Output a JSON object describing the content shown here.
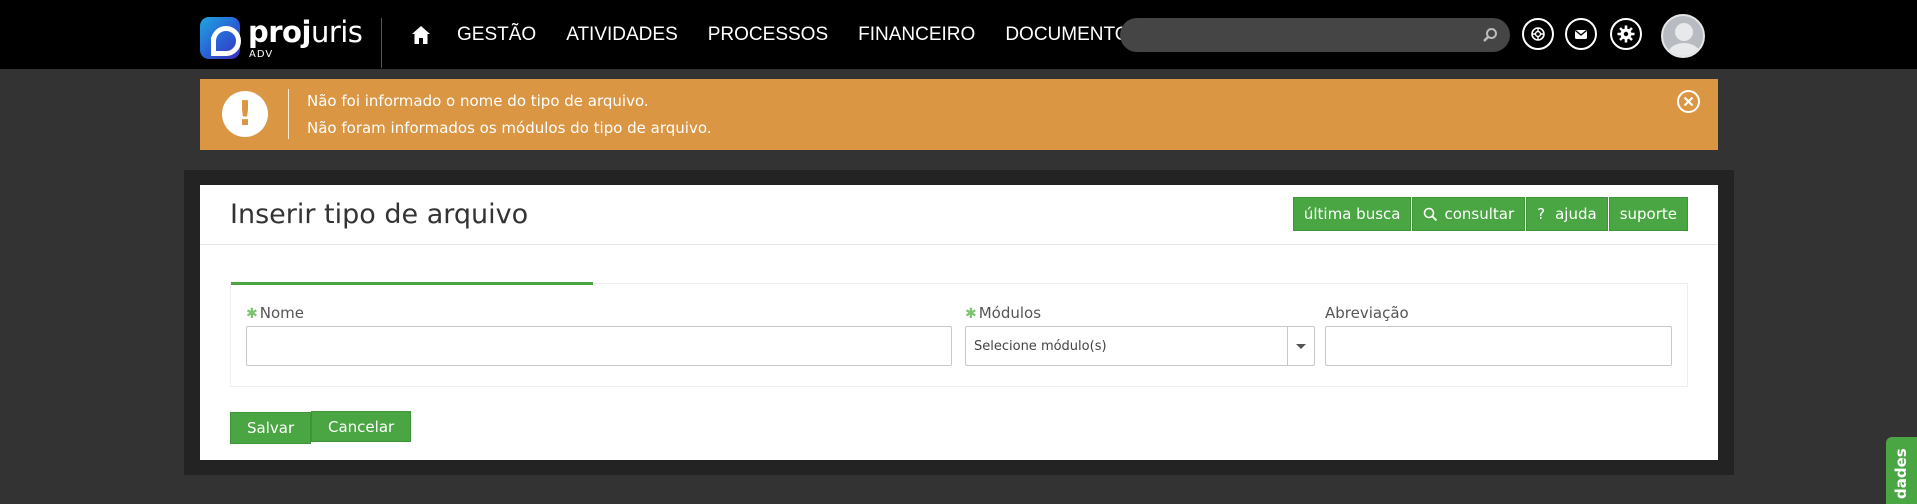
{
  "brand": {
    "name_bold": "proj",
    "name_light": "uris",
    "subtitle": "ADV"
  },
  "nav": {
    "items": [
      {
        "label": "GESTÃO"
      },
      {
        "label": "ATIVIDADES"
      },
      {
        "label": "PROCESSOS"
      },
      {
        "label": "FINANCEIRO"
      },
      {
        "label": "DOCUMENTOS"
      }
    ],
    "search_placeholder": ""
  },
  "alert": {
    "color": "#db9644",
    "icon": "!",
    "messages": [
      "Não foi informado o nome do tipo de arquivo.",
      "Não foram informados os módulos do tipo de arquivo."
    ]
  },
  "page": {
    "title": "Inserir tipo de arquivo"
  },
  "toolbar": {
    "last_search": "última busca",
    "consult": "consultar",
    "help": "ajuda",
    "help_icon": "?",
    "support": "suporte"
  },
  "form": {
    "name_label": "Nome",
    "name_value": "",
    "modules_label": "Módulos",
    "modules_placeholder": "Selecione módulo(s)",
    "abbrev_label": "Abreviação",
    "abbrev_value": "",
    "required_marker": "✱"
  },
  "actions": {
    "save": "Salvar",
    "cancel": "Cancelar"
  },
  "side_tab": {
    "label": "dades"
  },
  "colors": {
    "accent_green": "#4aa643",
    "navbar": "#000000",
    "background": "#333333"
  }
}
